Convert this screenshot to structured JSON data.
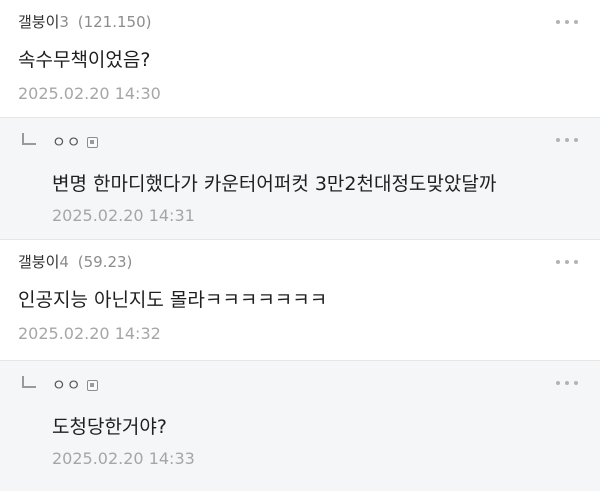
{
  "comments": [
    {
      "type": "top",
      "author": "갤붕이",
      "number": "3",
      "ip": "(121.150)",
      "text": "속수무책이었음?",
      "time": "2025.02.20 14:30"
    },
    {
      "type": "reply",
      "author": "ㅇㅇ",
      "text": "변명 한마디했다가 카운터어퍼컷 3만2천대정도맞았달까",
      "time": "2025.02.20 14:31"
    },
    {
      "type": "top",
      "author": "갤붕이",
      "number": "4",
      "ip": "(59.23)",
      "text": "인공지능 아닌지도 몰라ㅋㅋㅋㅋㅋㅋㅋ",
      "time": "2025.02.20 14:32"
    },
    {
      "type": "reply",
      "author": "ㅇㅇ",
      "text": "도청당한거야?",
      "time": "2025.02.20 14:33"
    }
  ],
  "icons": {
    "more": "more-options-icon",
    "reply": "reply-arrow-icon",
    "fixed_nick": "fixed-nickname-icon"
  }
}
